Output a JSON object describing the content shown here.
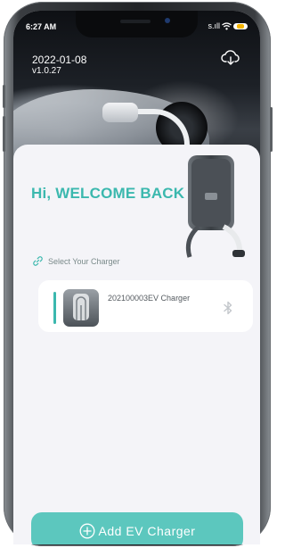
{
  "status_bar": {
    "time": "6:27 AM",
    "signal": "s.ıll"
  },
  "header": {
    "date": "2022-01-08",
    "version": "v1.0.27",
    "cloud_icon": "cloud-download-icon"
  },
  "welcome": {
    "title": "Hi, WELCOME BACK"
  },
  "charger_section": {
    "label": "Select Your Charger",
    "link_icon": "link-icon",
    "devices": [
      {
        "name": "202100003EV Charger",
        "status_icon": "bluetooth-icon"
      }
    ]
  },
  "add_button": {
    "label": "Add EV Charger",
    "icon": "plus-circle-icon"
  },
  "colors": {
    "accent": "#3bb8ae",
    "button": "#5cc7be",
    "background": "#f4f4f8"
  }
}
